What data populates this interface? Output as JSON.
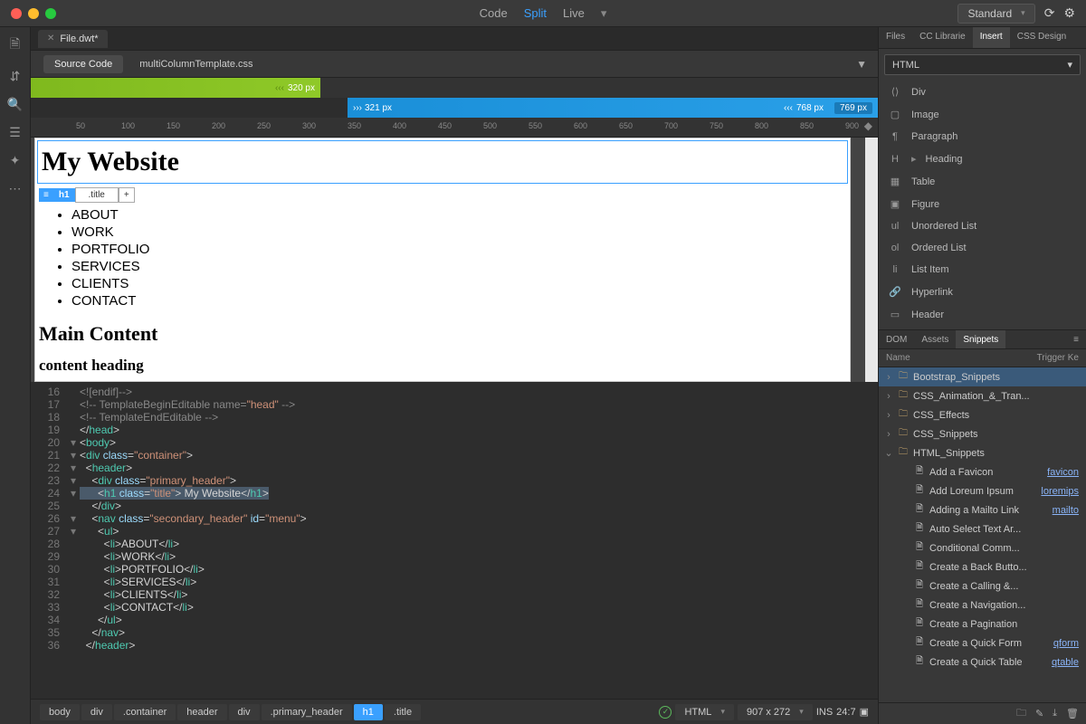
{
  "titlebar": {
    "views": [
      "Code",
      "Split",
      "Live"
    ],
    "active_view": "Split",
    "workspace": "Standard"
  },
  "file_tab": "File.dwt*",
  "source_row": {
    "btn": "Source Code",
    "link": "multiColumnTemplate.css"
  },
  "breakpoints": {
    "seg1": "320  px",
    "seg2_left": "321  px",
    "seg2_right": "768  px",
    "seg2_extra": "769  px"
  },
  "ruler_ticks": [
    "50",
    "100",
    "150",
    "200",
    "250",
    "300",
    "350",
    "400",
    "450",
    "500",
    "550",
    "600",
    "650",
    "700",
    "750",
    "800",
    "850",
    "900"
  ],
  "preview": {
    "title": "My Website",
    "badge_tag": "h1",
    "badge_class": ".title",
    "nav": [
      "ABOUT",
      "WORK",
      "PORTFOLIO",
      "SERVICES",
      "CLIENTS",
      "CONTACT"
    ],
    "h2": "Main Content",
    "h3": "content heading"
  },
  "code_lines": [
    {
      "n": 16,
      "f": "",
      "seg": [
        [
          "c-comment",
          "<![endif]-->"
        ]
      ]
    },
    {
      "n": 17,
      "f": "",
      "seg": [
        [
          "c-comment",
          "<!-- TemplateBeginEditable name="
        ],
        [
          "c-str",
          "\"head\""
        ],
        [
          "c-comment",
          " -->"
        ]
      ]
    },
    {
      "n": 18,
      "f": "",
      "seg": [
        [
          "c-comment",
          "<!-- TemplateEndEditable -->"
        ]
      ]
    },
    {
      "n": 19,
      "f": "",
      "seg": [
        [
          "c-pun",
          "</"
        ],
        [
          "c-tag",
          "head"
        ],
        [
          "c-pun",
          ">"
        ]
      ]
    },
    {
      "n": 20,
      "f": "▾",
      "seg": [
        [
          "c-pun",
          "<"
        ],
        [
          "c-tag",
          "body"
        ],
        [
          "c-pun",
          ">"
        ]
      ]
    },
    {
      "n": 21,
      "f": "▾",
      "seg": [
        [
          "c-pun",
          "<"
        ],
        [
          "c-tag",
          "div"
        ],
        [
          "c-txt",
          " "
        ],
        [
          "c-attr",
          "class"
        ],
        [
          "c-pun",
          "="
        ],
        [
          "c-str",
          "\"container\""
        ],
        [
          "c-pun",
          ">"
        ]
      ]
    },
    {
      "n": 22,
      "f": "▾",
      "seg": [
        [
          "c-txt",
          "  "
        ],
        [
          "c-pun",
          "<"
        ],
        [
          "c-tag",
          "header"
        ],
        [
          "c-pun",
          ">"
        ]
      ]
    },
    {
      "n": 23,
      "f": "▾",
      "seg": [
        [
          "c-txt",
          "    "
        ],
        [
          "c-pun",
          "<"
        ],
        [
          "c-tag",
          "div"
        ],
        [
          "c-txt",
          " "
        ],
        [
          "c-attr",
          "class"
        ],
        [
          "c-pun",
          "="
        ],
        [
          "c-str",
          "\"primary_header\""
        ],
        [
          "c-pun",
          ">"
        ]
      ]
    },
    {
      "n": 24,
      "f": "▾",
      "hl": true,
      "seg": [
        [
          "c-txt",
          "      "
        ],
        [
          "c-pun",
          "<"
        ],
        [
          "c-tag",
          "h1"
        ],
        [
          "c-txt",
          " "
        ],
        [
          "c-attr",
          "class"
        ],
        [
          "c-pun",
          "="
        ],
        [
          "c-str",
          "\"title\""
        ],
        [
          "c-pun",
          ">"
        ],
        [
          "c-txt",
          " My Website"
        ],
        [
          "c-pun",
          "</"
        ],
        [
          "c-tag",
          "h1"
        ],
        [
          "c-pun",
          ">"
        ]
      ]
    },
    {
      "n": 25,
      "f": "",
      "seg": [
        [
          "c-txt",
          "    "
        ],
        [
          "c-pun",
          "</"
        ],
        [
          "c-tag",
          "div"
        ],
        [
          "c-pun",
          ">"
        ]
      ]
    },
    {
      "n": 26,
      "f": "▾",
      "seg": [
        [
          "c-txt",
          "    "
        ],
        [
          "c-pun",
          "<"
        ],
        [
          "c-tag",
          "nav"
        ],
        [
          "c-txt",
          " "
        ],
        [
          "c-attr",
          "class"
        ],
        [
          "c-pun",
          "="
        ],
        [
          "c-str",
          "\"secondary_header\""
        ],
        [
          "c-txt",
          " "
        ],
        [
          "c-attr",
          "id"
        ],
        [
          "c-pun",
          "="
        ],
        [
          "c-str",
          "\"menu\""
        ],
        [
          "c-pun",
          ">"
        ]
      ]
    },
    {
      "n": 27,
      "f": "▾",
      "seg": [
        [
          "c-txt",
          "      "
        ],
        [
          "c-pun",
          "<"
        ],
        [
          "c-tag",
          "ul"
        ],
        [
          "c-pun",
          ">"
        ]
      ]
    },
    {
      "n": 28,
      "f": "",
      "seg": [
        [
          "c-txt",
          "        "
        ],
        [
          "c-pun",
          "<"
        ],
        [
          "c-tag",
          "li"
        ],
        [
          "c-pun",
          ">"
        ],
        [
          "c-txt",
          "ABOUT"
        ],
        [
          "c-pun",
          "</"
        ],
        [
          "c-tag",
          "li"
        ],
        [
          "c-pun",
          ">"
        ]
      ]
    },
    {
      "n": 29,
      "f": "",
      "seg": [
        [
          "c-txt",
          "        "
        ],
        [
          "c-pun",
          "<"
        ],
        [
          "c-tag",
          "li"
        ],
        [
          "c-pun",
          ">"
        ],
        [
          "c-txt",
          "WORK"
        ],
        [
          "c-pun",
          "</"
        ],
        [
          "c-tag",
          "li"
        ],
        [
          "c-pun",
          ">"
        ]
      ]
    },
    {
      "n": 30,
      "f": "",
      "seg": [
        [
          "c-txt",
          "        "
        ],
        [
          "c-pun",
          "<"
        ],
        [
          "c-tag",
          "li"
        ],
        [
          "c-pun",
          ">"
        ],
        [
          "c-txt",
          "PORTFOLIO"
        ],
        [
          "c-pun",
          "</"
        ],
        [
          "c-tag",
          "li"
        ],
        [
          "c-pun",
          ">"
        ]
      ]
    },
    {
      "n": 31,
      "f": "",
      "seg": [
        [
          "c-txt",
          "        "
        ],
        [
          "c-pun",
          "<"
        ],
        [
          "c-tag",
          "li"
        ],
        [
          "c-pun",
          ">"
        ],
        [
          "c-txt",
          "SERVICES"
        ],
        [
          "c-pun",
          "</"
        ],
        [
          "c-tag",
          "li"
        ],
        [
          "c-pun",
          ">"
        ]
      ]
    },
    {
      "n": 32,
      "f": "",
      "seg": [
        [
          "c-txt",
          "        "
        ],
        [
          "c-pun",
          "<"
        ],
        [
          "c-tag",
          "li"
        ],
        [
          "c-pun",
          ">"
        ],
        [
          "c-txt",
          "CLIENTS"
        ],
        [
          "c-pun",
          "</"
        ],
        [
          "c-tag",
          "li"
        ],
        [
          "c-pun",
          ">"
        ]
      ]
    },
    {
      "n": 33,
      "f": "",
      "seg": [
        [
          "c-txt",
          "        "
        ],
        [
          "c-pun",
          "<"
        ],
        [
          "c-tag",
          "li"
        ],
        [
          "c-pun",
          ">"
        ],
        [
          "c-txt",
          "CONTACT"
        ],
        [
          "c-pun",
          "</"
        ],
        [
          "c-tag",
          "li"
        ],
        [
          "c-pun",
          ">"
        ]
      ]
    },
    {
      "n": 34,
      "f": "",
      "seg": [
        [
          "c-txt",
          "      "
        ],
        [
          "c-pun",
          "</"
        ],
        [
          "c-tag",
          "ul"
        ],
        [
          "c-pun",
          ">"
        ]
      ]
    },
    {
      "n": 35,
      "f": "",
      "seg": [
        [
          "c-txt",
          "    "
        ],
        [
          "c-pun",
          "</"
        ],
        [
          "c-tag",
          "nav"
        ],
        [
          "c-pun",
          ">"
        ]
      ]
    },
    {
      "n": 36,
      "f": "",
      "seg": [
        [
          "c-txt",
          "  "
        ],
        [
          "c-pun",
          "</"
        ],
        [
          "c-tag",
          "header"
        ],
        [
          "c-pun",
          ">"
        ]
      ]
    }
  ],
  "status": {
    "crumbs": [
      "body",
      "div",
      ".container",
      "header",
      "div",
      ".primary_header",
      "h1",
      ".title"
    ],
    "active_idx": 6,
    "lang": "HTML",
    "size": "907 x 272",
    "ins": "INS",
    "pos": "24:7"
  },
  "right": {
    "top_tabs": [
      "Files",
      "CC Librarie",
      "Insert",
      "CSS Design"
    ],
    "top_active": "Insert",
    "dropdown": "HTML",
    "insert_items": [
      {
        "ico": "⟨⟩",
        "t": "Div"
      },
      {
        "ico": "▢",
        "t": "Image"
      },
      {
        "ico": "¶",
        "t": "Paragraph"
      },
      {
        "ico": "H",
        "t": "Heading",
        "arrow": true
      },
      {
        "ico": "▦",
        "t": "Table"
      },
      {
        "ico": "▣",
        "t": "Figure"
      },
      {
        "ico": "ul",
        "t": "Unordered List"
      },
      {
        "ico": "ol",
        "t": "Ordered List"
      },
      {
        "ico": "li",
        "t": "List Item"
      },
      {
        "ico": "🔗",
        "t": "Hyperlink"
      },
      {
        "ico": "▭",
        "t": "Header"
      }
    ],
    "bottom_tabs": [
      "DOM",
      "Assets",
      "Snippets"
    ],
    "bottom_active": "Snippets",
    "cols": [
      "Name",
      "Trigger Ke"
    ],
    "tree": [
      {
        "d": 0,
        "tw": "›",
        "ico": "folder",
        "name": "Bootstrap_Snippets",
        "sel": true
      },
      {
        "d": 0,
        "tw": "›",
        "ico": "folder",
        "name": "CSS_Animation_&_Tran..."
      },
      {
        "d": 0,
        "tw": "›",
        "ico": "folder",
        "name": "CSS_Effects"
      },
      {
        "d": 0,
        "tw": "›",
        "ico": "folder",
        "name": "CSS_Snippets"
      },
      {
        "d": 0,
        "tw": "⌄",
        "ico": "folder",
        "name": "HTML_Snippets"
      },
      {
        "d": 1,
        "tw": "",
        "ico": "file",
        "name": "Add a Favicon",
        "trig": "favicon"
      },
      {
        "d": 1,
        "tw": "",
        "ico": "file",
        "name": "Add Loreum Ipsum",
        "trig": "loremips"
      },
      {
        "d": 1,
        "tw": "",
        "ico": "file",
        "name": "Adding a Mailto Link",
        "trig": "mailto"
      },
      {
        "d": 1,
        "tw": "",
        "ico": "file",
        "name": "Auto Select Text Ar..."
      },
      {
        "d": 1,
        "tw": "",
        "ico": "file",
        "name": "Conditional Comm..."
      },
      {
        "d": 1,
        "tw": "",
        "ico": "file",
        "name": "Create a Back Butto..."
      },
      {
        "d": 1,
        "tw": "",
        "ico": "file",
        "name": "Create a Calling &..."
      },
      {
        "d": 1,
        "tw": "",
        "ico": "file",
        "name": "Create a Navigation..."
      },
      {
        "d": 1,
        "tw": "",
        "ico": "file",
        "name": "Create a Pagination"
      },
      {
        "d": 1,
        "tw": "",
        "ico": "file",
        "name": "Create a Quick Form",
        "trig": "qform"
      },
      {
        "d": 1,
        "tw": "",
        "ico": "file",
        "name": "Create a Quick Table",
        "trig": "qtable"
      }
    ]
  }
}
